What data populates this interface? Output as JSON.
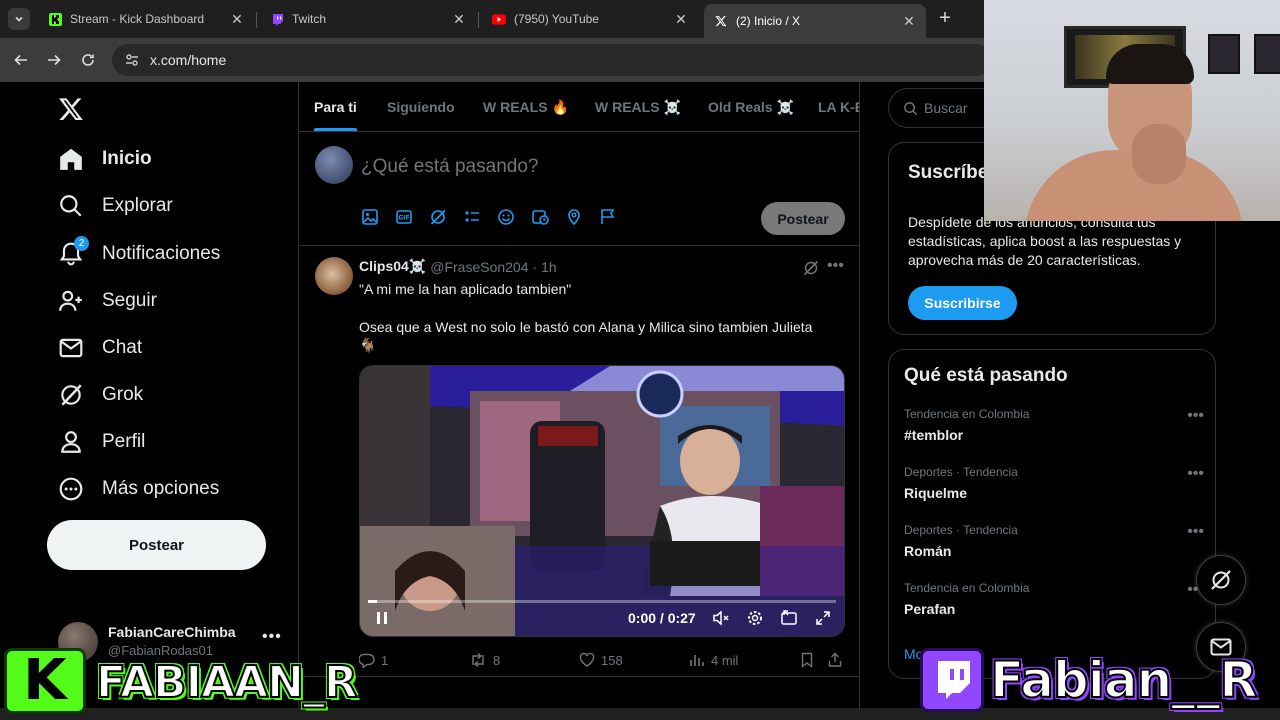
{
  "browser": {
    "tabs": [
      {
        "title": "Stream - Kick Dashboard",
        "icon": "kick-icon"
      },
      {
        "title": "Twitch",
        "icon": "twitch-icon"
      },
      {
        "title": "(7950) YouTube",
        "icon": "youtube-icon"
      },
      {
        "title": "(2) Inicio / X",
        "icon": "x-icon",
        "active": true
      }
    ],
    "url": "x.com/home"
  },
  "nav": {
    "items": [
      {
        "label": "Inicio",
        "icon": "home-icon",
        "active": true
      },
      {
        "label": "Explorar",
        "icon": "search-icon"
      },
      {
        "label": "Notificaciones",
        "icon": "bell-icon",
        "badge": "2"
      },
      {
        "label": "Seguir",
        "icon": "follow-icon"
      },
      {
        "label": "Chat",
        "icon": "mail-icon"
      },
      {
        "label": "Grok",
        "icon": "grok-icon"
      },
      {
        "label": "Perfil",
        "icon": "person-icon"
      },
      {
        "label": "Más opciones",
        "icon": "more-circle-icon"
      }
    ],
    "post_label": "Postear",
    "account": {
      "name": "FabianCareChimba",
      "handle": "@FabianRodas01"
    }
  },
  "feed_tabs": [
    "Para ti",
    "Siguiendo",
    "W REALS 🔥",
    "W REALS ☠️",
    "Old Reals ☠️",
    "LA K-E"
  ],
  "composer": {
    "placeholder": "¿Qué está pasando?",
    "post_label": "Postear"
  },
  "tweet": {
    "name": "Clips04☠️",
    "handle": "@FraseSon204",
    "time": "· 1h",
    "line1": "\"A mi me la han aplicado tambien\"",
    "line2": "Osea que a West no solo le bastó con Alana y Milica sino tambien Julieta",
    "line3": "🐐",
    "video_time": "0:00 / 0:27",
    "video_progress": 0.02,
    "stats": {
      "replies": "1",
      "reposts": "8",
      "likes": "158",
      "views": "4 mil"
    }
  },
  "right": {
    "search_placeholder": "Buscar",
    "premium": {
      "title": "Suscríbete a Premium",
      "text": "Despídete de los anuncios, consulta tus estadísticas, aplica boost a las respuestas y aprovecha más de 20 características.",
      "button": "Suscribirse"
    },
    "trends_title": "Qué está pasando",
    "trends": [
      {
        "context": "Tendencia en Colombia",
        "title": "#temblor"
      },
      {
        "context": "Deportes · Tendencia",
        "title": "Riquelme"
      },
      {
        "context": "Deportes · Tendencia",
        "title": "Román"
      },
      {
        "context": "Tendencia en Colombia",
        "title": "Perafan"
      }
    ],
    "more_link": "Mostrar más"
  },
  "overlays": {
    "kick_name": "FABIAAN_R",
    "twitch_name": "Fabian__R"
  },
  "colors": {
    "accent": "#1d9bf0",
    "kick": "#53fc18",
    "twitch": "#9146ff"
  }
}
